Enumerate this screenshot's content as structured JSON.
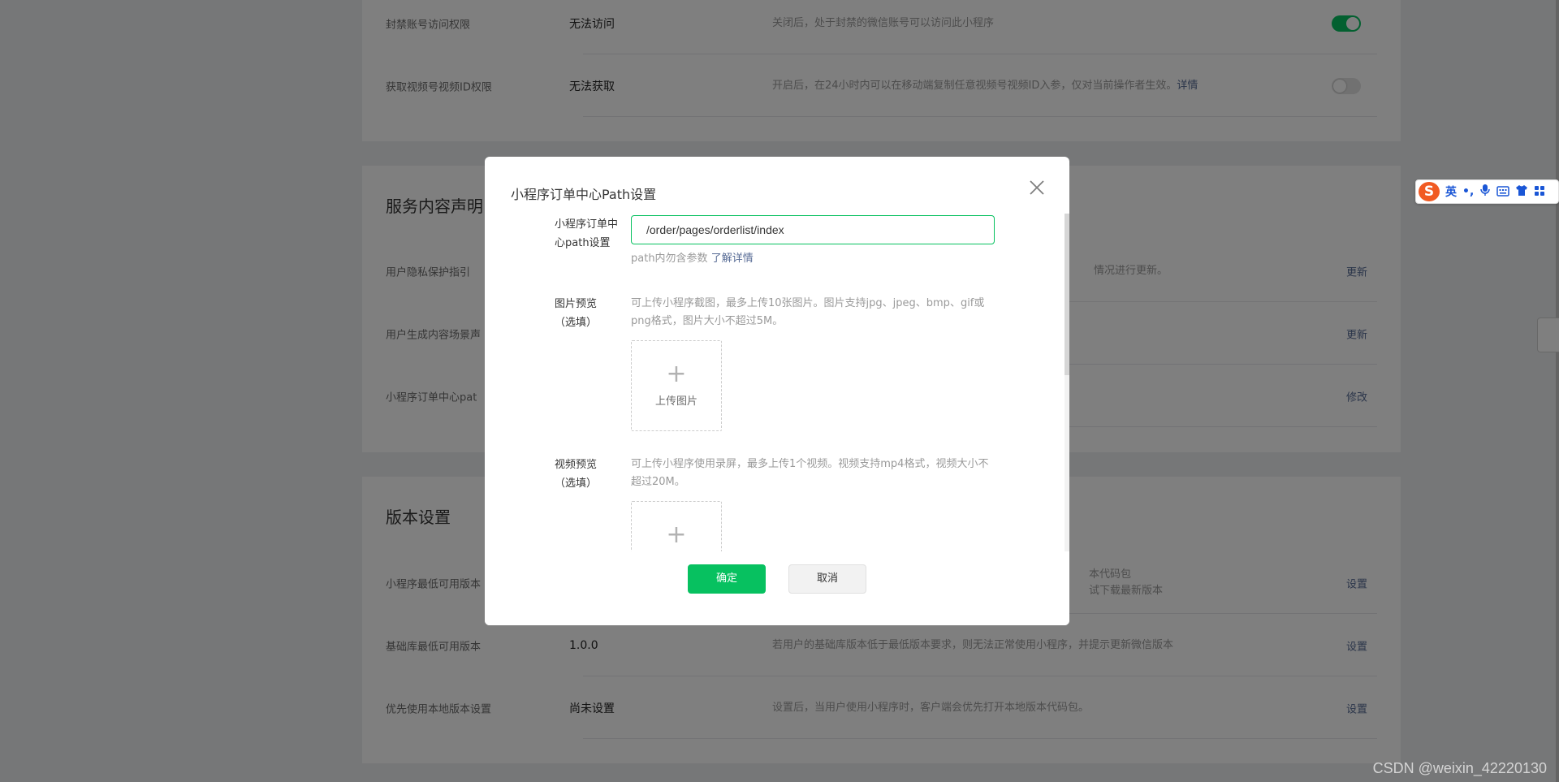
{
  "background": {
    "section1": {
      "rows": [
        {
          "label": "封禁账号访问权限",
          "value": "无法访问",
          "desc": "关闭后，处于封禁的微信账号可以访问此小程序",
          "toggle": "on"
        },
        {
          "label": "获取视频号视频ID权限",
          "value": "无法获取",
          "desc": "开启后，在24小时内可以在移动端复制任意视频号视频ID入参，仅对当前操作者生效。",
          "desc_link": "详情",
          "toggle": "off"
        }
      ]
    },
    "section2": {
      "title": "服务内容声明",
      "rows": [
        {
          "label": "用户隐私保护指引",
          "desc": "情况进行更新。",
          "action": "更新"
        },
        {
          "label": "用户生成内容场景声",
          "action": "更新"
        },
        {
          "label": "小程序订单中心pat",
          "action": "修改"
        }
      ]
    },
    "section3": {
      "title": "版本设置",
      "rows": [
        {
          "label": "小程序最低可用版本",
          "desc_line1": "本代码包",
          "desc_line2": "试下载最新版本",
          "action": "设置"
        },
        {
          "label": "基础库最低可用版本",
          "value": "1.0.0",
          "desc": "若用户的基础库版本低于最低版本要求，则无法正常使用小程序，并提示更新微信版本",
          "action": "设置"
        },
        {
          "label": "优先使用本地版本设置",
          "value": "尚未设置",
          "desc": "设置后，当用户使用小程序时，客户端会优先打开本地版本代码包。",
          "action": "设置"
        }
      ]
    }
  },
  "dialog": {
    "title": "小程序订单中心Path设置",
    "close_icon": "close-icon",
    "path_label": "小程序订单中心path设置",
    "path_value": "/order/pages/orderlist/index",
    "path_tip": "path内勿含参数",
    "path_tip_link": "了解详情",
    "image_label": "图片预览（选填）",
    "image_tip": "可上传小程序截图，最多上传10张图片。图片支持jpg、jpeg、bmp、gif或png格式，图片大小不超过5M。",
    "image_upload_label": "上传图片",
    "video_label": "视频预览（选填）",
    "video_tip": "可上传小程序使用录屏，最多上传1个视频。视频支持mp4格式，视频大小不超过20M。",
    "confirm_label": "确定",
    "cancel_label": "取消"
  },
  "ime": {
    "logo": "S",
    "lang": "英",
    "punct": "•,",
    "icons": [
      "microphone-icon",
      "keyboard-icon",
      "shirt-icon",
      "grid-icon"
    ]
  },
  "watermark": "CSDN @weixin_42220130",
  "colors": {
    "primary": "#07c160",
    "link": "#576b95",
    "overlay": "rgba(0,0,0,0.5)"
  }
}
